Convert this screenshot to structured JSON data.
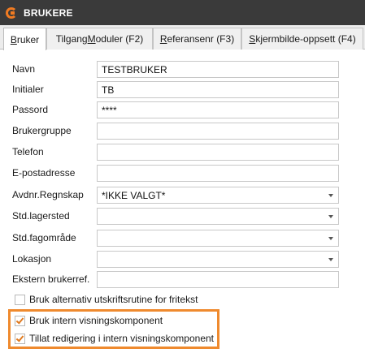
{
  "window": {
    "title": "BRUKERE"
  },
  "tabs": [
    {
      "label": "Bruker",
      "shortcut": ""
    },
    {
      "label": "Tilgang Moduler (F2)",
      "pre": "Tilgang ",
      "mid": "M",
      "post": "oduler (F2)"
    },
    {
      "label": "Referansenr (F3)",
      "pre": "",
      "mid": "R",
      "post": "eferansenr (F3)"
    },
    {
      "label": "Skjermbilde-oppsett (F4)",
      "pre": "",
      "mid": "S",
      "post": "kjermbilde-oppsett (F4)"
    }
  ],
  "tab0": {
    "pre": "",
    "mid": "B",
    "post": "ruker"
  },
  "form": {
    "navn": {
      "label": "Navn",
      "value": "TESTBRUKER"
    },
    "initialer": {
      "label": "Initialer",
      "value": "TB"
    },
    "passord": {
      "label": "Passord",
      "value": "****"
    },
    "brukergruppe": {
      "label": "Brukergruppe",
      "value": ""
    },
    "telefon": {
      "label": "Telefon",
      "value": ""
    },
    "epost": {
      "label": "E-postadresse",
      "value": ""
    },
    "avdnr": {
      "label": "Avdnr.Regnskap",
      "value": "*IKKE VALGT*"
    },
    "lager": {
      "label": "Std.lagersted",
      "value": ""
    },
    "fagomrade": {
      "label": "Std.fagområde",
      "value": ""
    },
    "lokasjon": {
      "label": "Lokasjon",
      "value": ""
    },
    "ekstern": {
      "label": "Ekstern brukerref.",
      "value": ""
    }
  },
  "checkboxes": {
    "alt_utskrift": {
      "label": "Bruk alternativ utskriftsrutine for fritekst",
      "checked": false
    },
    "intern_visning": {
      "label": "Bruk intern visningskomponent",
      "checked": true
    },
    "tillat_redigering": {
      "label": "Tillat redigering i intern visningskomponent",
      "checked": true
    }
  },
  "colors": {
    "accent": "#ef8a2e",
    "titlebar": "#3a3a3a",
    "check": "#e07a1f"
  }
}
